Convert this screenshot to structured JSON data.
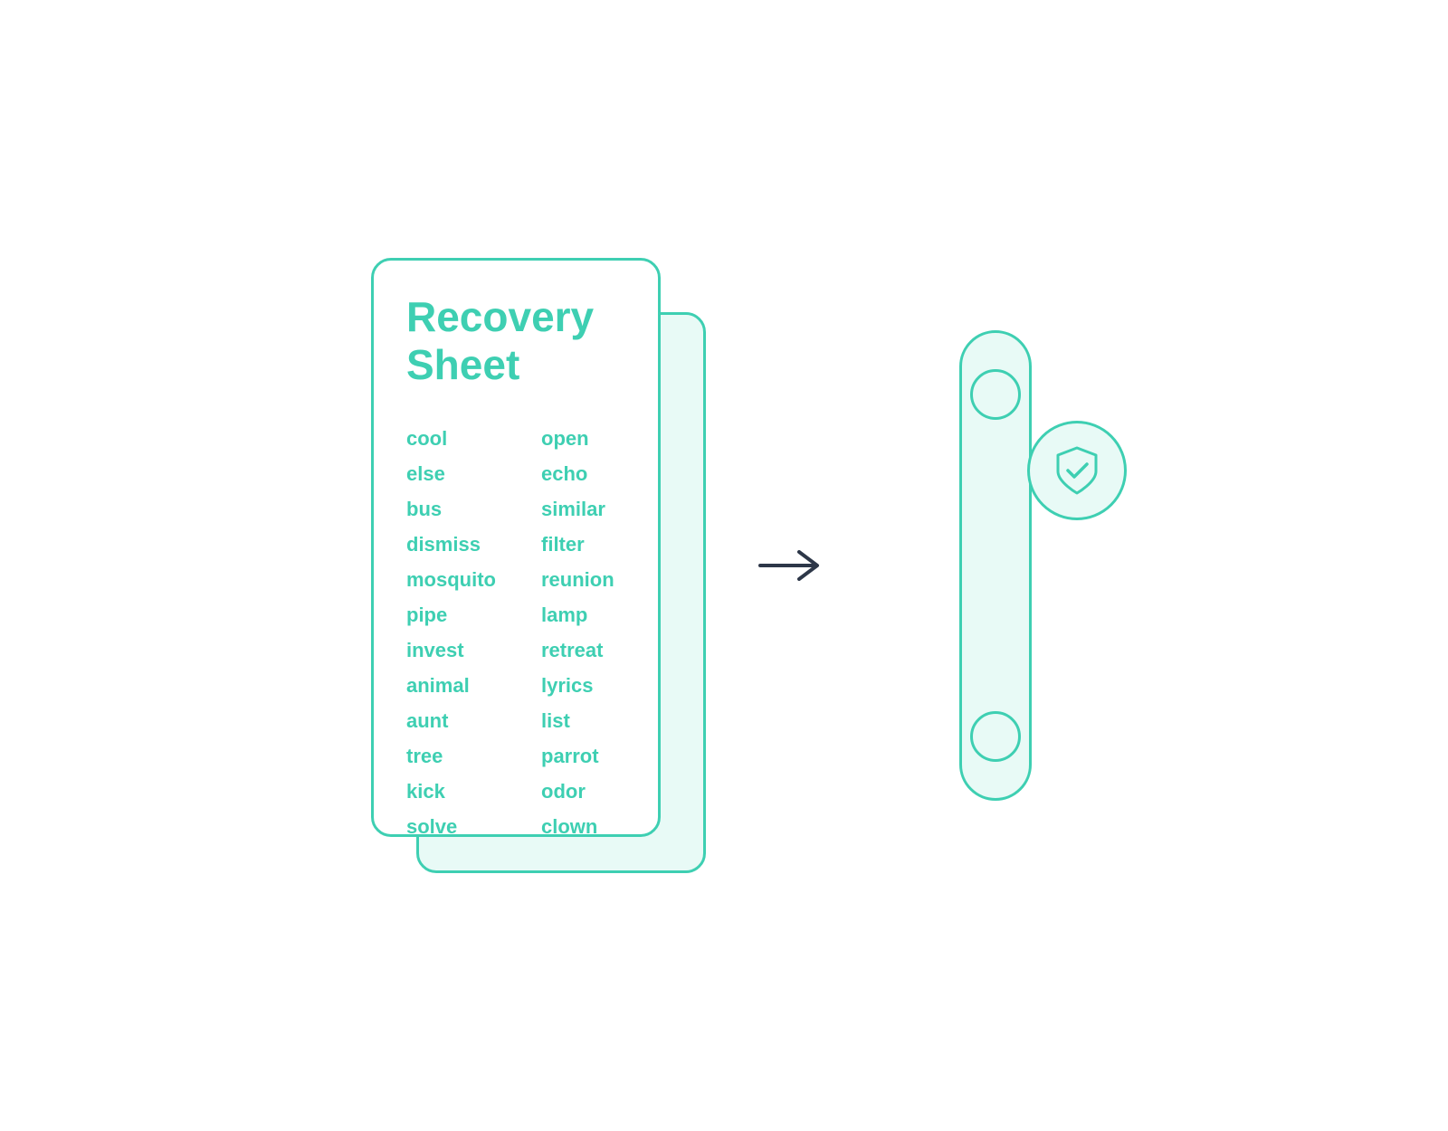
{
  "card": {
    "title_line1": "Recovery",
    "title_line2": "Sheet"
  },
  "words": {
    "col1": [
      "cool",
      "else",
      "bus",
      "dismiss",
      "mosquito",
      "pipe",
      "invest",
      "animal",
      "aunt",
      "tree",
      "kick",
      "solve"
    ],
    "col2": [
      "open",
      "echo",
      "similar",
      "filter",
      "reunion",
      "lamp",
      "retreat",
      "lyrics",
      "list",
      "parrot",
      "odor",
      "clown"
    ]
  },
  "arrow": "→",
  "colors": {
    "teal": "#3ecfb2",
    "light_teal": "#e8faf6",
    "dark": "#2d3748"
  }
}
